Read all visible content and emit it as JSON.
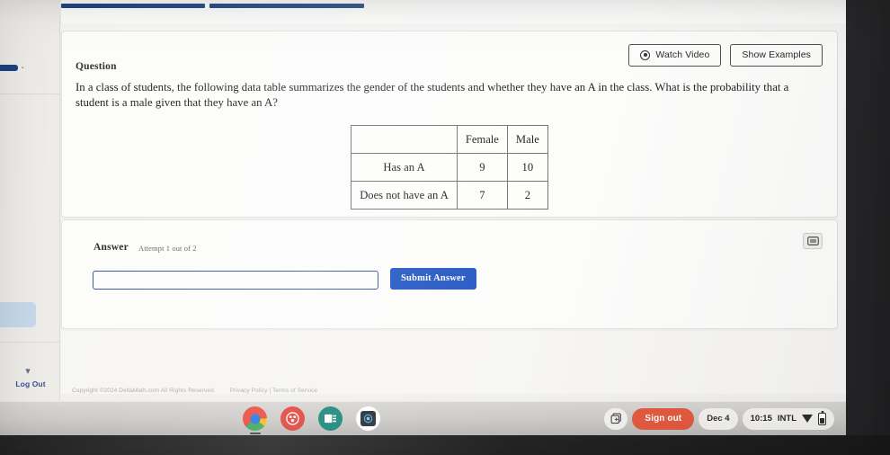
{
  "app": {
    "name": "DeltaMath"
  },
  "sidebar": {
    "logout_label": "Log Out",
    "chevron_glyph": "▾",
    "dot_glyph": "▪"
  },
  "question_card": {
    "heading": "Question",
    "buttons": {
      "watch_video": "Watch Video",
      "show_examples": "Show Examples"
    },
    "prompt": "In a class of students, the following data table summarizes the gender of the students and whether they have an A in the class. What is the probability that a student is a male given that they have an A?",
    "table": {
      "corner": "",
      "columns": [
        "Female",
        "Male"
      ],
      "rows": [
        {
          "label": "Has an A",
          "values": [
            "9",
            "10"
          ]
        },
        {
          "label": "Does not have an A",
          "values": [
            "7",
            "2"
          ]
        }
      ]
    }
  },
  "answer_card": {
    "heading": "Answer",
    "attempt_text": "Attempt 1 out of 2",
    "input_value": "",
    "input_placeholder": "",
    "submit_label": "Submit Answer"
  },
  "footer": {
    "copyright": "Copyright ©2024 DeltaMath.com All Rights Reserved.",
    "links": "Privacy Policy | Terms of Service"
  },
  "shelf": {
    "apps": [
      {
        "name": "chrome",
        "label": "Chrome"
      },
      {
        "name": "red-app",
        "label": ""
      },
      {
        "name": "teal-app",
        "label": ""
      },
      {
        "name": "dark-app",
        "label": ""
      }
    ],
    "sign_out_label": "Sign out",
    "date": "Dec 4",
    "time": "10:15",
    "locale": "INTL"
  },
  "colors": {
    "accent_blue": "#1a50c0",
    "progress_bar": "#1b3f7d",
    "sign_out": "#e2553a",
    "sidebar_highlight": "#c3d6e8",
    "input_border": "#2f4f96"
  }
}
